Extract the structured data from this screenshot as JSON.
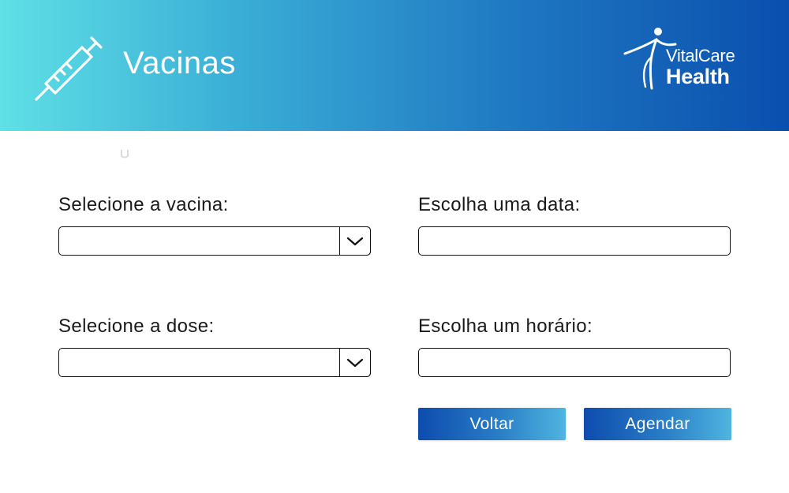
{
  "header": {
    "title": "Vacinas",
    "icon": "syringe-icon",
    "logo": {
      "line1": "VitalCare",
      "line2": "Health",
      "icon": "runner-figure-icon"
    }
  },
  "form": {
    "vaccine": {
      "label": "Selecione a vacina:",
      "value": ""
    },
    "dose": {
      "label": "Selecione a dose:",
      "value": ""
    },
    "date": {
      "label": "Escolha uma data:",
      "value": ""
    },
    "time": {
      "label": "Escolha um horário:",
      "value": ""
    }
  },
  "actions": {
    "back_label": "Voltar",
    "schedule_label": "Agendar"
  },
  "colors": {
    "header_gradient": [
      "#5fe0e6",
      "#0a4fae"
    ],
    "button_gradient": [
      "#0d4cae",
      "#4fb5e0"
    ],
    "text": "#1a1a1a"
  }
}
